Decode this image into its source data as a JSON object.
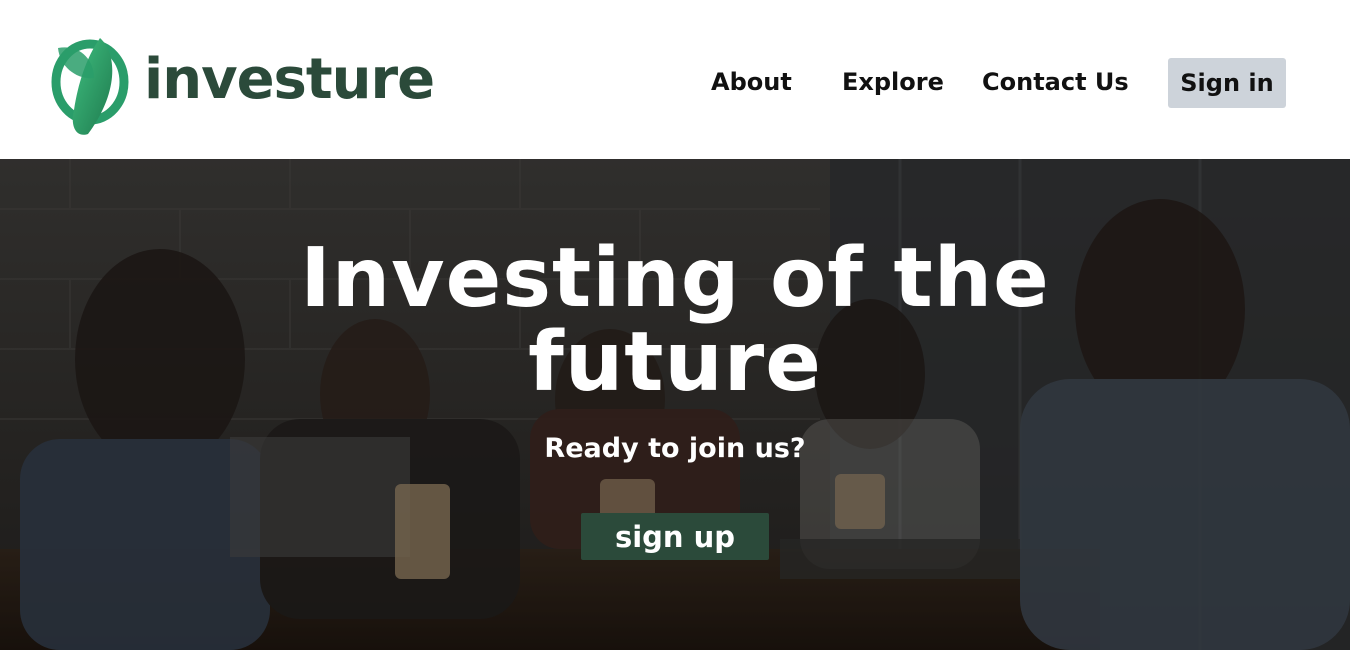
{
  "brand": {
    "name": "investure",
    "text_color": "#2b4a3a",
    "mark_colors": [
      "#2a9d6a",
      "#1f7a4e",
      "#3fbf80"
    ],
    "logo_icon": "leaf-ring-logo-icon"
  },
  "nav": {
    "items": [
      {
        "label": "About"
      },
      {
        "label": "Explore"
      },
      {
        "label": "Contact Us"
      }
    ],
    "signin_label": "Sign in",
    "signin_bg": "#cdd3da"
  },
  "hero": {
    "title": "Investing of the future",
    "subtitle": "Ready to join us?",
    "signup_label": "sign up",
    "signup_bg": "#2b4a3a",
    "background_image": "team-meeting-photo"
  }
}
